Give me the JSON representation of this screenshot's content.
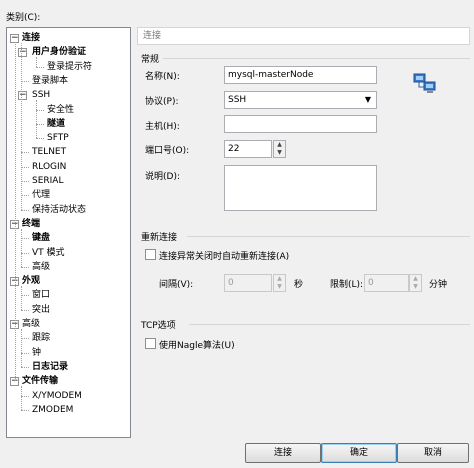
{
  "category_label": "类别(C):",
  "tree": {
    "items": [
      {
        "label": "连接",
        "bold": true,
        "expander": "−",
        "level": 0
      },
      {
        "label": "用户身份验证",
        "bold": true,
        "expander": "−",
        "level": 1
      },
      {
        "label": "登录提示符",
        "bold": false,
        "expander": "",
        "level": 2
      },
      {
        "label": "登录脚本",
        "bold": false,
        "expander": "",
        "level": 1
      },
      {
        "label": "SSH",
        "bold": false,
        "expander": "−",
        "level": 1
      },
      {
        "label": "安全性",
        "bold": false,
        "expander": "",
        "level": 2
      },
      {
        "label": "隧道",
        "bold": true,
        "expander": "",
        "level": 2
      },
      {
        "label": "SFTP",
        "bold": false,
        "expander": "",
        "level": 2
      },
      {
        "label": "TELNET",
        "bold": false,
        "expander": "",
        "level": 1
      },
      {
        "label": "RLOGIN",
        "bold": false,
        "expander": "",
        "level": 1
      },
      {
        "label": "SERIAL",
        "bold": false,
        "expander": "",
        "level": 1
      },
      {
        "label": "代理",
        "bold": false,
        "expander": "",
        "level": 1
      },
      {
        "label": "保持活动状态",
        "bold": false,
        "expander": "",
        "level": 1
      },
      {
        "label": "终端",
        "bold": true,
        "expander": "−",
        "level": 0
      },
      {
        "label": "键盘",
        "bold": true,
        "expander": "",
        "level": 1
      },
      {
        "label": "VT 模式",
        "bold": false,
        "expander": "",
        "level": 1
      },
      {
        "label": "高级",
        "bold": false,
        "expander": "",
        "level": 1
      },
      {
        "label": "外观",
        "bold": true,
        "expander": "−",
        "level": 0
      },
      {
        "label": "窗口",
        "bold": false,
        "expander": "",
        "level": 1
      },
      {
        "label": "突出",
        "bold": false,
        "expander": "",
        "level": 1
      },
      {
        "label": "高级",
        "bold": false,
        "expander": "−",
        "level": 0
      },
      {
        "label": "跟踪",
        "bold": false,
        "expander": "",
        "level": 1
      },
      {
        "label": "钟",
        "bold": false,
        "expander": "",
        "level": 1
      },
      {
        "label": "日志记录",
        "bold": true,
        "expander": "",
        "level": 1
      },
      {
        "label": "文件传输",
        "bold": true,
        "expander": "−",
        "level": 0
      },
      {
        "label": "X/YMODEM",
        "bold": false,
        "expander": "",
        "level": 1
      },
      {
        "label": "ZMODEM",
        "bold": false,
        "expander": "",
        "level": 1
      }
    ]
  },
  "panel": {
    "title": "连接",
    "general": {
      "group_label": "常规",
      "name_label": "名称(N):",
      "name_value": "mysql-masterNode",
      "protocol_label": "协议(P):",
      "protocol_value": "SSH",
      "host_label": "主机(H):",
      "host_value": "",
      "port_label": "端口号(O):",
      "port_value": "22",
      "desc_label": "说明(D):",
      "desc_value": "",
      "icon": "network-computers-icon"
    },
    "reconnect": {
      "group_label": "重新连接",
      "checkbox_label": "连接异常关闭时自动重新连接(A)",
      "interval_label": "间隔(V):",
      "interval_value": "0",
      "interval_unit": "秒",
      "limit_label": "限制(L):",
      "limit_value": "0",
      "limit_unit": "分钟"
    },
    "tcp": {
      "group_label": "TCP选项",
      "nagle_label": "使用Nagle算法(U)"
    }
  },
  "buttons": {
    "connect": "连接",
    "ok": "确定",
    "cancel": "取消"
  },
  "colors": {
    "window_bg": "#f0f0f0",
    "border": "#828790",
    "button_accent": "#3c7fb1"
  }
}
